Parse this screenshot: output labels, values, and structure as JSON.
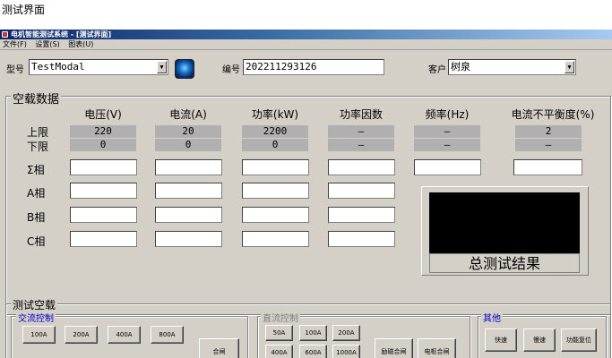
{
  "caption": "测试界面",
  "window": {
    "title": "电机智能测试系统 - [测试界面]",
    "menu": [
      "文件(F)",
      "设置(S)",
      "图表(U)"
    ]
  },
  "top": {
    "model_label": "型号",
    "model_value": "TestModal",
    "code_label": "编号",
    "code_value": "202211293126",
    "customer_label": "客户",
    "customer_value": "树泉"
  },
  "noload": {
    "title": "空载数据",
    "columns": [
      "电压(V)",
      "电流(A)",
      "功率(kW)",
      "功率因数",
      "频率(Hz)",
      "电流不平衡度(%)"
    ],
    "upper_label": "上限",
    "lower_label": "下限",
    "upper": [
      "220",
      "20",
      "2200",
      "—",
      "—",
      "2"
    ],
    "lower": [
      "0",
      "0",
      "0",
      "—",
      "—",
      "—"
    ],
    "rows": [
      "Σ相",
      "A相",
      "B相",
      "C相"
    ],
    "result_label": "总测试结果"
  },
  "test": {
    "title": "测试空载",
    "ac": {
      "title": "交流控制",
      "buttons": [
        "100A",
        "200A",
        "400A",
        "800A"
      ],
      "close": "合闸"
    },
    "dc": {
      "title": "直流控制",
      "row1": [
        "50A",
        "100A",
        "200A"
      ],
      "row2": [
        "400A",
        "600A",
        "1000A"
      ],
      "excite": "励磁合闸",
      "armature": "电枢合闸"
    },
    "other": {
      "title": "其他",
      "buttons": [
        "快速",
        "慢速",
        "功能复位"
      ]
    }
  }
}
